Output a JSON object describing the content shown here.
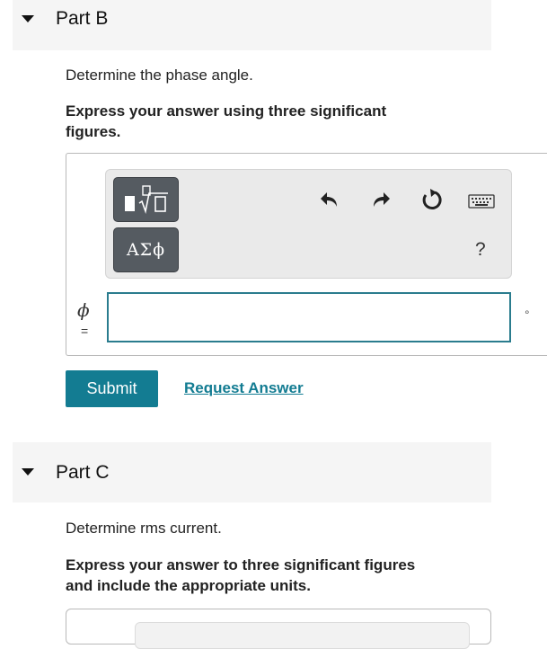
{
  "part_b": {
    "title": "Part B",
    "question": "Determine the phase angle.",
    "instruction_line1": "Express your answer using three significant",
    "instruction_line2": "figures.",
    "toolbar": {
      "templates_button": "templates-icon",
      "greek_button_label": "ΑΣϕ",
      "undo": "undo-icon",
      "redo": "redo-icon",
      "reset": "reset-icon",
      "keyboard": "keyboard-icon",
      "help_label": "?"
    },
    "variable_label": "ϕ",
    "equals_label": "=",
    "answer_value": "",
    "unit_label": "∘",
    "submit_label": "Submit",
    "request_label": "Request Answer"
  },
  "part_c": {
    "title": "Part C",
    "question": "Determine rms current.",
    "instruction_line1": "Express your answer to three significant figures",
    "instruction_line2": "and include the appropriate units."
  },
  "colors": {
    "accent": "#137c92",
    "header_bg": "#f5f5f5",
    "tool_button": "#555b61"
  }
}
